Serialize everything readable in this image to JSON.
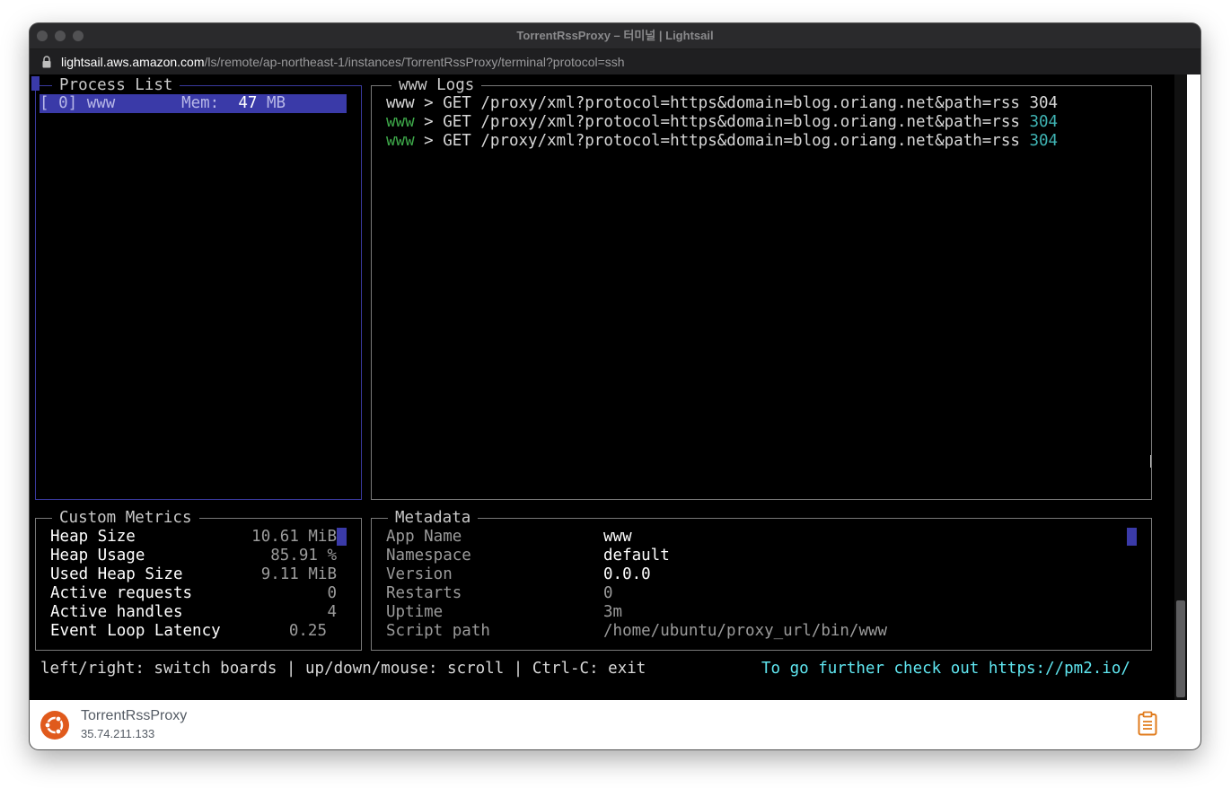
{
  "window": {
    "title": "TorrentRssProxy – 터미널 | Lightsail"
  },
  "address": {
    "host": "lightsail.aws.amazon.com",
    "path": "/ls/remote/ap-northeast-1/instances/TorrentRssProxy/terminal?protocol=ssh"
  },
  "process_list": {
    "title": "Process List",
    "item": {
      "index": "[ 0]",
      "name": "www",
      "mem_label": "Mem:",
      "mem_value": "47",
      "mem_unit": "MB"
    }
  },
  "logs": {
    "title": "www Logs",
    "lines": [
      {
        "app": "www",
        "request": " > GET /proxy/xml?protocol=https&domain=blog.oriang.net&path=rss",
        "status": "304"
      },
      {
        "app": "www",
        "request": " > GET /proxy/xml?protocol=https&domain=blog.oriang.net&path=rss",
        "status": "304"
      },
      {
        "app": "www",
        "request": " > GET /proxy/xml?protocol=https&domain=blog.oriang.net&path=rss",
        "status": "304"
      }
    ]
  },
  "custom_metrics": {
    "title": "Custom Metrics",
    "rows": [
      {
        "label": "Heap Size",
        "value": "10.61 MiB"
      },
      {
        "label": "Heap Usage",
        "value": "85.91 %"
      },
      {
        "label": "Used Heap Size",
        "value": "9.11 MiB"
      },
      {
        "label": "Active requests",
        "value": "0"
      },
      {
        "label": "Active handles",
        "value": "4"
      },
      {
        "label": "Event Loop Latency",
        "value": "0.25"
      }
    ]
  },
  "metadata": {
    "title": "Metadata",
    "rows": [
      {
        "label": "App Name",
        "value": "www"
      },
      {
        "label": "Namespace",
        "value": "default"
      },
      {
        "label": "Version",
        "value": "0.0.0"
      },
      {
        "label": "Restarts",
        "value": "0"
      },
      {
        "label": "Uptime",
        "value": "3m"
      },
      {
        "label": "Script path",
        "value": "/home/ubuntu/proxy_url/bin/www"
      }
    ]
  },
  "help_bar": {
    "keys": "left/right: switch boards | up/down/mouse: scroll | Ctrl-C: exit",
    "promo": "To go further check out https://pm2.io/"
  },
  "instance": {
    "name": "TorrentRssProxy",
    "ip": "35.74.211.133",
    "os_icon": "ubuntu-icon",
    "clipboard_icon": "clipboard-icon",
    "accent_color": "#e05a1c"
  }
}
